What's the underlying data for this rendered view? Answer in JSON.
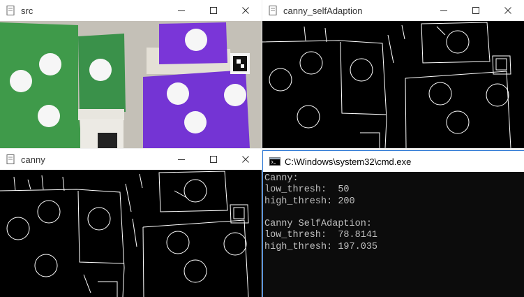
{
  "windows": {
    "src": {
      "title": "src"
    },
    "canny_self": {
      "title": "canny_selfAdaption"
    },
    "canny": {
      "title": "canny"
    },
    "cmd": {
      "title": "C:\\Windows\\system32\\cmd.exe",
      "lines": [
        "Canny:",
        "low_thresh:  50",
        "high_thresh: 200",
        "",
        "Canny SelfAdaption:",
        "low_thresh:  78.8141",
        "high_thresh: 197.035"
      ]
    }
  },
  "icons": {
    "minimize": "minimize-icon",
    "maximize": "maximize-icon",
    "close": "close-icon",
    "app": "window-app-icon",
    "console": "console-icon"
  },
  "colors": {
    "green_paper": "#3f9a4a",
    "purple_paper": "#7a36d8",
    "table": "#c9c5bc",
    "edge": "#ffffff",
    "console_bg": "#0c0c0c",
    "console_text": "#c0c0c0"
  }
}
